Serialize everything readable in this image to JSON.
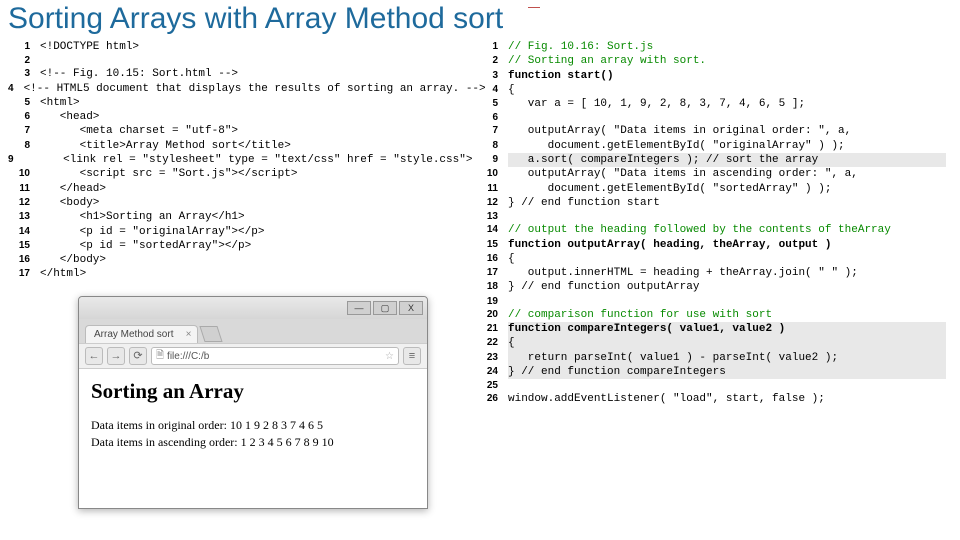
{
  "title": "Sorting Arrays with Array Method sort",
  "left_code": [
    {
      "n": "1",
      "t": "<!DOCTYPE html>"
    },
    {
      "n": "2",
      "t": ""
    },
    {
      "n": "3",
      "t": "<!-- Fig. 10.15: Sort.html -->"
    },
    {
      "n": "4",
      "t": "<!-- HTML5 document that displays the results of sorting an array. -->"
    },
    {
      "n": "5",
      "t": "<html>"
    },
    {
      "n": "6",
      "t": "   <head>"
    },
    {
      "n": "7",
      "t": "      <meta charset = \"utf-8\">"
    },
    {
      "n": "8",
      "t": "      <title>Array Method sort</title>"
    },
    {
      "n": "9",
      "t": "      <link rel = \"stylesheet\" type = \"text/css\" href = \"style.css\">"
    },
    {
      "n": "10",
      "t": "      <script src = \"Sort.js\"></script>"
    },
    {
      "n": "11",
      "t": "   </head>"
    },
    {
      "n": "12",
      "t": "   <body>"
    },
    {
      "n": "13",
      "t": "      <h1>Sorting an Array</h1>"
    },
    {
      "n": "14",
      "t": "      <p id = \"originalArray\"></p>"
    },
    {
      "n": "15",
      "t": "      <p id = \"sortedArray\"></p>"
    },
    {
      "n": "16",
      "t": "   </body>"
    },
    {
      "n": "17",
      "t": "</html>"
    }
  ],
  "right_code": [
    {
      "n": "1",
      "cls": "cmt",
      "t": "// Fig. 10.16: Sort.js"
    },
    {
      "n": "2",
      "cls": "cmt",
      "t": "// Sorting an array with sort."
    },
    {
      "n": "3",
      "cls": "kw",
      "t": "function start()"
    },
    {
      "n": "4",
      "cls": "",
      "t": "{"
    },
    {
      "n": "5",
      "cls": "",
      "t": "   var a = [ 10, 1, 9, 2, 8, 3, 7, 4, 6, 5 ];"
    },
    {
      "n": "6",
      "cls": "",
      "t": ""
    },
    {
      "n": "7",
      "cls": "",
      "t": "   outputArray( \"Data items in original order: \", a,"
    },
    {
      "n": "8",
      "cls": "",
      "t": "      document.getElementById( \"originalArray\" ) );"
    },
    {
      "n": "9",
      "cls": "hl",
      "t": "   a.sort( compareIntegers ); // sort the array"
    },
    {
      "n": "10",
      "cls": "",
      "t": "   outputArray( \"Data items in ascending order: \", a,"
    },
    {
      "n": "11",
      "cls": "",
      "t": "      document.getElementById( \"sortedArray\" ) );"
    },
    {
      "n": "12",
      "cls": "",
      "t": "} // end function start"
    },
    {
      "n": "13",
      "cls": "",
      "t": ""
    },
    {
      "n": "14",
      "cls": "cmt",
      "t": "// output the heading followed by the contents of theArray"
    },
    {
      "n": "15",
      "cls": "kw",
      "t": "function outputArray( heading, theArray, output )"
    },
    {
      "n": "16",
      "cls": "",
      "t": "{"
    },
    {
      "n": "17",
      "cls": "",
      "t": "   output.innerHTML = heading + theArray.join( \" \" );"
    },
    {
      "n": "18",
      "cls": "",
      "t": "} // end function outputArray"
    },
    {
      "n": "19",
      "cls": "",
      "t": ""
    },
    {
      "n": "20",
      "cls": "cmt",
      "t": "// comparison function for use with sort"
    },
    {
      "n": "21",
      "cls": "hl kw",
      "t": "function compareIntegers( value1, value2 )"
    },
    {
      "n": "22",
      "cls": "hl",
      "t": "{"
    },
    {
      "n": "23",
      "cls": "hl",
      "t": "   return parseInt( value1 ) - parseInt( value2 );"
    },
    {
      "n": "24",
      "cls": "hl",
      "t": "} // end function compareIntegers"
    },
    {
      "n": "25",
      "cls": "",
      "t": ""
    },
    {
      "n": "26",
      "cls": "",
      "t": "window.addEventListener( \"load\", start, false );"
    }
  ],
  "browser": {
    "tab_title": "Array Method sort",
    "url_prefix": "file:///C:/b",
    "page_heading": "Sorting an Array",
    "line1": "Data items in original order: 10 1 9 2 8 3 7 4 6 5",
    "line2": "Data items in ascending order: 1 2 3 4 5 6 7 8 9 10",
    "win_min": "—",
    "win_max": "▢",
    "win_close": "X",
    "back": "←",
    "fwd": "→",
    "reload": "⟳",
    "star": "☆",
    "menu": "≡"
  }
}
